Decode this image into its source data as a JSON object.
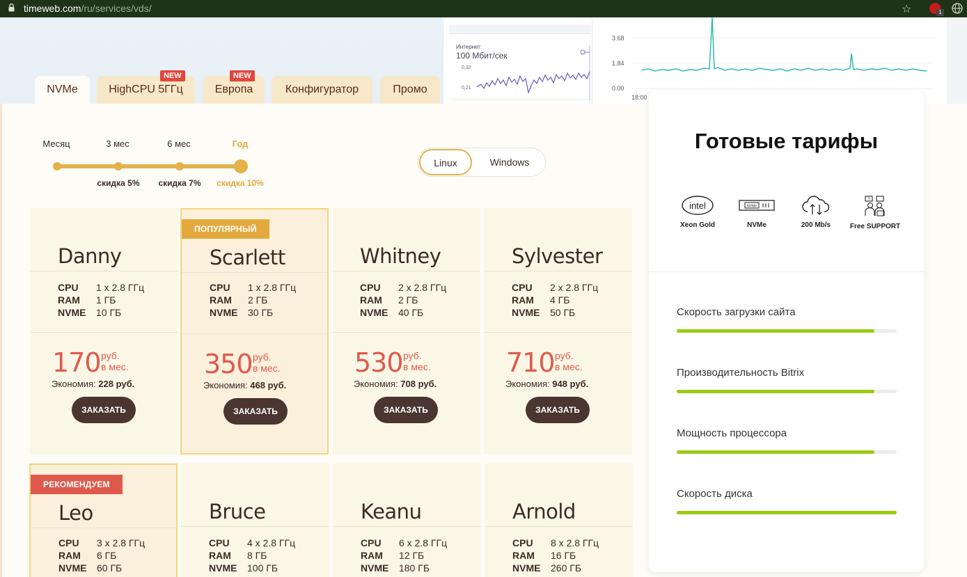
{
  "browser": {
    "url_host": "timeweb.com",
    "url_path": "/ru/services/vds/",
    "ext_badge": "1"
  },
  "hero": {
    "internet_label": "Интернет:",
    "internet_speed": "100 Мбит/сек",
    "tick_a1": "0,32",
    "tick_a2": "0,21",
    "tick_b1": "3.68",
    "tick_b2": "1.84",
    "tick_b3": "0.00",
    "tick_b4": "18:00"
  },
  "tabs": [
    {
      "label": "NVMe",
      "active": true
    },
    {
      "label": "HighCPU 5ГГц",
      "badge": "NEW"
    },
    {
      "label": "Европа",
      "badge": "NEW"
    },
    {
      "label": "Конфигуратор"
    },
    {
      "label": "Промо"
    }
  ],
  "period": {
    "options": [
      "Месяц",
      "3 мес",
      "6 мес",
      "Год"
    ],
    "discounts": [
      "скидка 5%",
      "скидка 7%",
      "скидка 10%"
    ],
    "selected": "Год"
  },
  "os": {
    "options": [
      "Linux",
      "Windows"
    ],
    "selected": "Linux"
  },
  "spec_keys": {
    "cpu": "CPU",
    "ram": "RAM",
    "disk": "NVME"
  },
  "price_unit_line1": "руб.",
  "price_unit_line2": "в мес.",
  "saving_label": "Экономия:",
  "order_label": "ЗАКАЗАТЬ",
  "plans": [
    {
      "name": "Danny",
      "cpu": "1 x 2.8 ГГц",
      "ram": "1 ГБ",
      "disk": "10 ГБ",
      "price": "170",
      "saving": "228 руб."
    },
    {
      "name": "Scarlett",
      "badge": "ПОПУЛЯРНЫЙ",
      "cpu": "1 x 2.8 ГГц",
      "ram": "2 ГБ",
      "disk": "30 ГБ",
      "price": "350",
      "saving": "468 руб."
    },
    {
      "name": "Whitney",
      "cpu": "2 x 2.8 ГГц",
      "ram": "2 ГБ",
      "disk": "40 ГБ",
      "price": "530",
      "saving": "708 руб."
    },
    {
      "name": "Sylvester",
      "cpu": "2 x 2.8 ГГц",
      "ram": "4 ГБ",
      "disk": "50 ГБ",
      "price": "710",
      "saving": "948 руб."
    },
    {
      "name": "Leo",
      "badge": "РЕКОМЕНДУЕМ",
      "cpu": "3 x 2.8 ГГц",
      "ram": "6 ГБ",
      "disk": "60 ГБ"
    },
    {
      "name": "Bruce",
      "cpu": "4 x 2.8 ГГц",
      "ram": "8 ГБ",
      "disk": "100 ГБ"
    },
    {
      "name": "Keanu",
      "cpu": "6 x 2.8 ГГц",
      "ram": "12 ГБ",
      "disk": "180 ГБ"
    },
    {
      "name": "Arnold",
      "cpu": "8 x 2.8 ГГц",
      "ram": "16 ГБ",
      "disk": "260 ГБ"
    }
  ],
  "ready": {
    "title": "Готовые тарифы",
    "features": [
      {
        "label": "Xeon Gold",
        "icon": "intel-logo-icon"
      },
      {
        "label": "NVMe",
        "icon": "nvme-drive-icon",
        "chip_text": "NVMe"
      },
      {
        "label": "200 Mb/s",
        "icon": "cloud-transfer-icon"
      },
      {
        "label": "Free SUPPORT",
        "icon": "support-team-icon"
      }
    ],
    "intel_text": "intel",
    "metrics": [
      {
        "label": "Скорость загрузки сайта",
        "value": 0.9
      },
      {
        "label": "Производительность Bitrix",
        "value": 0.9
      },
      {
        "label": "Мощность процессора",
        "value": 0.9
      },
      {
        "label": "Скорость диска",
        "value": 1.0
      }
    ]
  },
  "colors": {
    "accent": "#e4b24b",
    "price": "#df5a4d",
    "button": "#4a3531",
    "metric": "#9bcb14",
    "badge_new": "#e2453b"
  }
}
